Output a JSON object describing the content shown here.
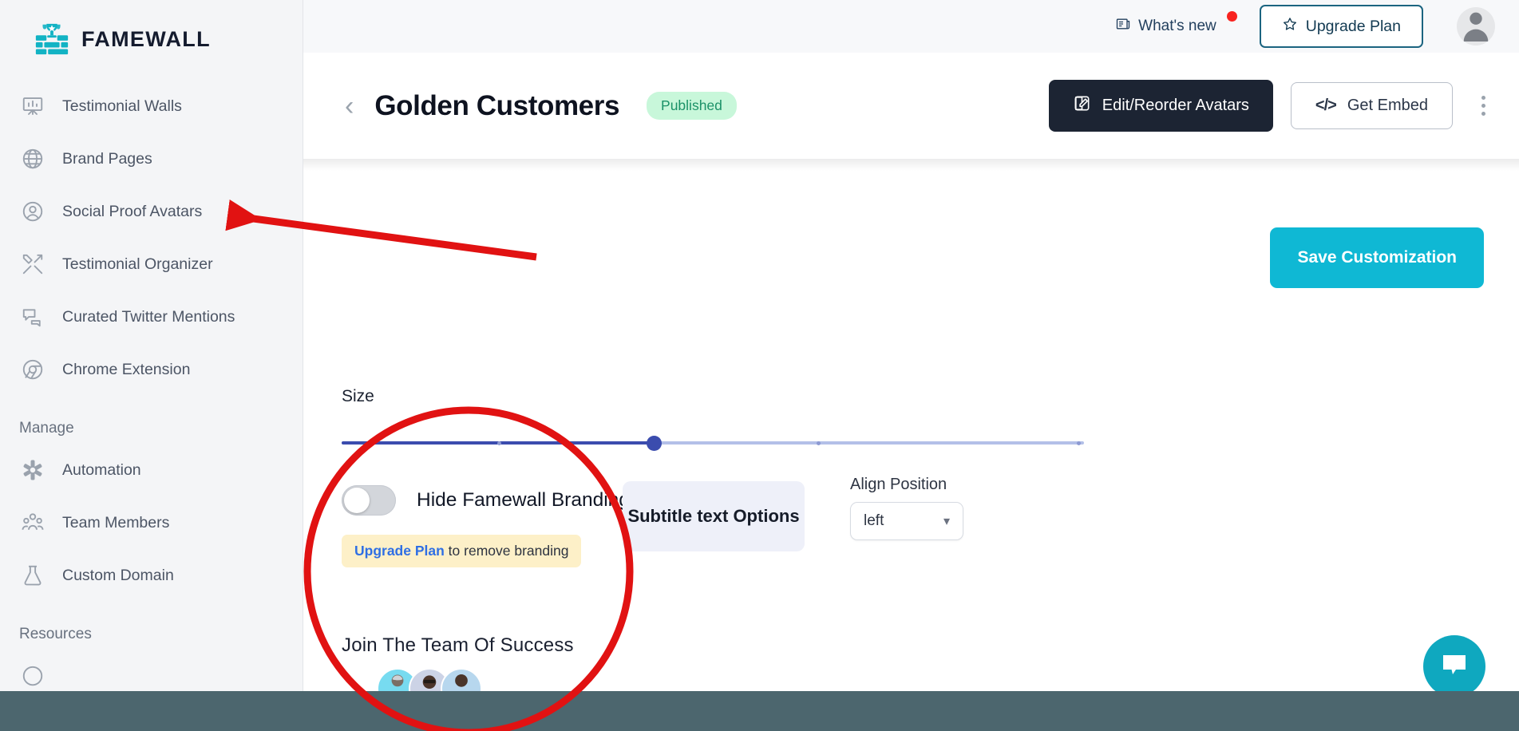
{
  "brand": {
    "name": "FAMEWALL",
    "logo_icon": "trophy-wall-icon"
  },
  "topbar": {
    "whats_new_label": "What's new",
    "whats_new_icon": "news-icon",
    "notification_dot": true,
    "upgrade_label": "Upgrade Plan",
    "upgrade_icon": "star-icon",
    "avatar_icon": "user-avatar-icon"
  },
  "sidebar": {
    "items": [
      {
        "label": "Testimonial Walls",
        "icon": "presentation-chart-icon"
      },
      {
        "label": "Brand Pages",
        "icon": "globe-icon"
      },
      {
        "label": "Social Proof Avatars",
        "icon": "user-circle-icon"
      },
      {
        "label": "Testimonial Organizer",
        "icon": "tools-icon"
      },
      {
        "label": "Curated Twitter Mentions",
        "icon": "chat-bubbles-icon"
      },
      {
        "label": "Chrome Extension",
        "icon": "chrome-icon"
      }
    ],
    "manage_section": "Manage",
    "manage_items": [
      {
        "label": "Automation",
        "icon": "asterisk-icon"
      },
      {
        "label": "Team Members",
        "icon": "people-group-icon"
      },
      {
        "label": "Custom Domain",
        "icon": "flask-icon"
      }
    ],
    "resources_section": "Resources"
  },
  "page_header": {
    "back_icon": "chevron-left-icon",
    "title": "Golden Customers",
    "status": "Published",
    "edit_label": "Edit/Reorder Avatars",
    "edit_icon": "pencil-square-icon",
    "embed_label": "Get Embed",
    "embed_icon": "code-icon",
    "more_icon": "kebab-menu-icon"
  },
  "main": {
    "size_label": "Size",
    "size_value_percent": 42,
    "hide_branding_label": "Hide Famewall Branding",
    "hide_branding_on": false,
    "upgrade_note_link": "Upgrade Plan",
    "upgrade_note_rest": " to remove branding",
    "subtitle_options_label": "Subtitle text Options",
    "align_position_label": "Align Position",
    "align_position_value": "left",
    "align_chevron_icon": "chevron-down-icon",
    "preview_title": "Join The Team Of Success",
    "preview_avatars": [
      {
        "name": "avatar-1",
        "bg": "#77dbf0"
      },
      {
        "name": "avatar-2",
        "bg": "#ccd3e6"
      },
      {
        "name": "avatar-3",
        "bg": "#b7d7ee"
      }
    ],
    "save_label": "Save Customization",
    "save_color": "#0fb8d4"
  },
  "chat_widget": {
    "icon": "chat-bubble-icon",
    "color": "#0fa8bf"
  },
  "annotations": {
    "arrow_color": "#e11212",
    "circle_color": "#e11212",
    "arrow_target": "Social Proof Avatars",
    "circle_target": "Join The Team Of Success preview"
  }
}
